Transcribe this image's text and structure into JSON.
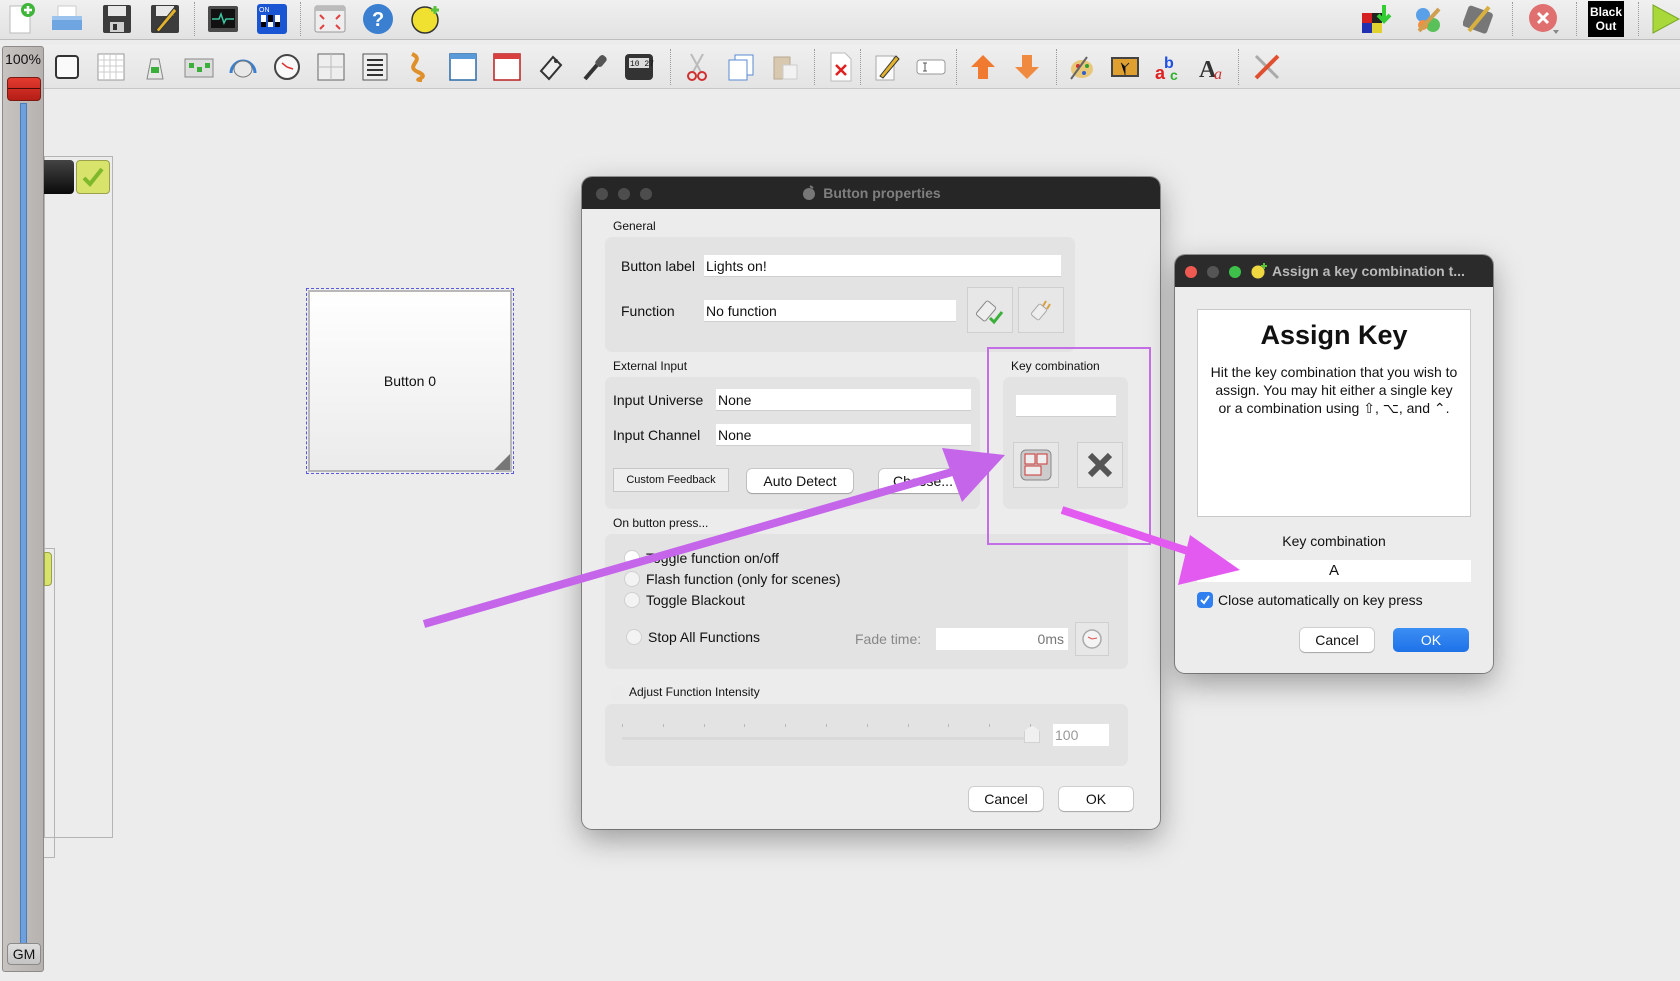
{
  "toolbar_main": {
    "items": [
      {
        "name": "new-workspace-icon"
      },
      {
        "name": "open-workspace-icon"
      },
      {
        "name": "save-workspace-icon"
      },
      {
        "name": "save-as-icon"
      },
      {
        "name": "dmx-monitor-icon"
      },
      {
        "name": "address-tool-icon"
      },
      {
        "name": "fullscreen-icon"
      },
      {
        "name": "help-icon"
      },
      {
        "name": "about-icon"
      }
    ],
    "right_items": [
      {
        "name": "load-mode-icon"
      },
      {
        "name": "design-mode-icon"
      },
      {
        "name": "operate-mode-icon"
      },
      {
        "name": "stop-all-icon"
      },
      {
        "name": "blackout-icon",
        "label_line1": "Black",
        "label_line2": "Out"
      },
      {
        "name": "play-icon"
      }
    ]
  },
  "toolbar_widgets": {
    "items": [
      "add-button-icon",
      "add-button-matrix-icon",
      "add-slider-icon",
      "add-slider-matrix-icon",
      "add-knob-icon",
      "add-speed-dial-icon",
      "add-xy-pad-icon",
      "add-cue-list-icon",
      "add-animation-icon",
      "add-frame-icon",
      "add-solo-frame-icon",
      "add-label-icon",
      "add-audio-triggers-icon",
      "add-clock-icon",
      "cut-icon",
      "copy-icon",
      "paste-icon",
      "delete-icon",
      "edit-properties-icon",
      "rename-icon",
      "raise-icon",
      "lower-icon",
      "background-color-icon",
      "background-image-icon",
      "font-color-icon",
      "font-icon",
      "virtual-console-settings-icon"
    ]
  },
  "grand_master": {
    "value_label": "100%",
    "level_percent": 100,
    "button_label": "GM"
  },
  "canvas": {
    "button_widget_label": "Button 0"
  },
  "button_properties": {
    "title": "Button properties",
    "general": {
      "group_label": "General",
      "button_label_caption": "Button label",
      "button_label_value": "Lights on!",
      "function_caption": "Function",
      "function_value": "No function"
    },
    "external_input": {
      "group_label": "External Input",
      "universe_caption": "Input Universe",
      "universe_value": "None",
      "channel_caption": "Input Channel",
      "channel_value": "None",
      "custom_feedback_label": "Custom Feedback",
      "auto_detect_label": "Auto Detect",
      "choose_label": "Choose..."
    },
    "key_combination": {
      "group_label": "Key combination",
      "value": ""
    },
    "on_press": {
      "group_label": "On button press...",
      "options": [
        {
          "label": "Toggle function on/off",
          "selected": true
        },
        {
          "label": "Flash function (only for scenes)",
          "selected": false
        },
        {
          "label": "Toggle Blackout",
          "selected": false
        },
        {
          "label": "Stop All Functions",
          "selected": false
        }
      ],
      "fade_time_caption": "Fade time:",
      "fade_time_value": "0ms"
    },
    "intensity": {
      "checkbox_label": "Adjust Function Intensity",
      "checked": false,
      "value": "100",
      "level_percent": 100
    },
    "cancel_label": "Cancel",
    "ok_label": "OK"
  },
  "assign_key_dialog": {
    "title": "Assign a key combination t...",
    "heading": "Assign Key",
    "description": "Hit the key combination that you wish to assign. You may hit either a single key or a combination using ⇧, ⌥, and ⌃.",
    "key_combination_caption": "Key combination",
    "key_combination_value": "A",
    "auto_close_label": "Close automatically on key press",
    "auto_close_checked": true,
    "cancel_label": "Cancel",
    "ok_label": "OK"
  },
  "annotations": {
    "color": "#c46ee6"
  }
}
